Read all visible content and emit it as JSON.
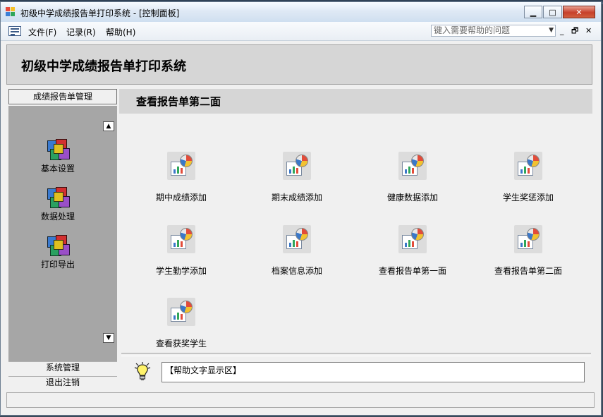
{
  "window": {
    "title": "初级中学成绩报告单打印系统 - [控制面板]",
    "controls": [
      "minimize",
      "maximize",
      "close"
    ]
  },
  "menu": {
    "items": [
      {
        "label": "文件(F)"
      },
      {
        "label": "记录(R)"
      },
      {
        "label": "帮助(H)"
      }
    ],
    "help_placeholder": "键入需要帮助的问题"
  },
  "form": {
    "title": "初级中学成绩报告单打印系统"
  },
  "sidebar": {
    "header": "成绩报告单管理",
    "items": [
      {
        "label": "基本设置",
        "icon": "cubes-icon"
      },
      {
        "label": "数据处理",
        "icon": "cubes-icon"
      },
      {
        "label": "打印导出",
        "icon": "cubes-icon"
      }
    ],
    "bottom_buttons": [
      {
        "label": "系统管理"
      },
      {
        "label": "退出注销"
      }
    ]
  },
  "main": {
    "title": "查看报告单第二面",
    "tiles": [
      {
        "label": "期中成绩添加",
        "icon": "report-chart-icon"
      },
      {
        "label": "期末成绩添加",
        "icon": "report-chart-icon"
      },
      {
        "label": "健康数据添加",
        "icon": "report-chart-icon"
      },
      {
        "label": "学生奖惩添加",
        "icon": "report-chart-icon"
      },
      {
        "label": "学生勤学添加",
        "icon": "report-chart-icon"
      },
      {
        "label": "档案信息添加",
        "icon": "report-chart-icon"
      },
      {
        "label": "查看报告单第一面",
        "icon": "report-chart-icon"
      },
      {
        "label": "查看报告单第二面",
        "icon": "report-chart-icon"
      },
      {
        "label": "查看获奖学生",
        "icon": "report-chart-icon"
      }
    ]
  },
  "help_area": {
    "text": "【帮助文字显示区】",
    "icon": "lightbulb-icon"
  }
}
